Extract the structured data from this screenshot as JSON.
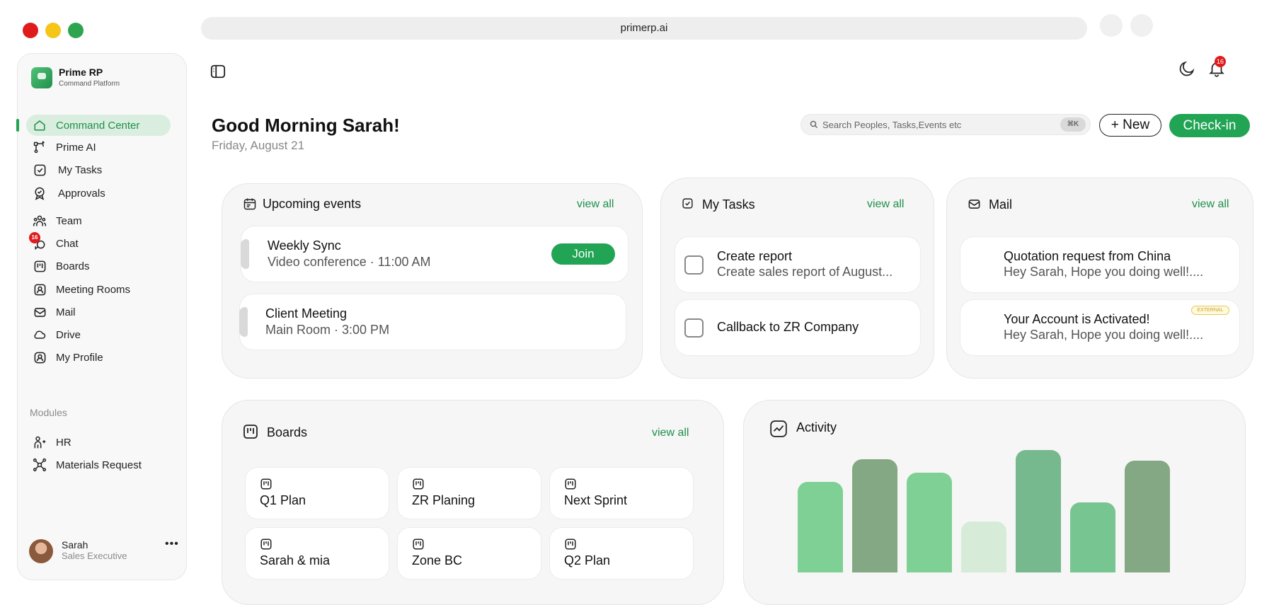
{
  "browser": {
    "url": "primerp.ai",
    "traffic_colors": [
      "#e01b1b",
      "#f5c518",
      "#2ea44f"
    ]
  },
  "brand": {
    "name": "Prime RP",
    "subtitle": "Command Platform"
  },
  "sidebar": {
    "items": [
      {
        "label": "Command Center",
        "icon": "home-icon",
        "active": true
      },
      {
        "label": "Prime AI",
        "icon": "ai-flow-icon"
      },
      {
        "label": "My Tasks",
        "icon": "checkbox-icon"
      },
      {
        "label": "Approvals",
        "icon": "badge-check-icon"
      },
      {
        "label": "Team",
        "icon": "team-icon"
      },
      {
        "label": "Chat",
        "icon": "chat-icon",
        "badge": "16"
      },
      {
        "label": "Boards",
        "icon": "board-icon"
      },
      {
        "label": "Meeting Rooms",
        "icon": "meeting-room-icon"
      },
      {
        "label": "Mail",
        "icon": "mail-icon"
      },
      {
        "label": "Drive",
        "icon": "cloud-icon"
      },
      {
        "label": "My Profile",
        "icon": "profile-icon"
      }
    ],
    "modules_label": "Modules",
    "modules": [
      {
        "label": "HR",
        "icon": "hr-icon"
      },
      {
        "label": "Materials Request",
        "icon": "materials-icon"
      }
    ],
    "user": {
      "name": "Sarah",
      "role": "Sales Executive",
      "more": "•••"
    }
  },
  "topbar": {
    "notification_count": "16"
  },
  "header": {
    "greeting": "Good Morning Sarah!",
    "date": "Friday, August 21",
    "search_placeholder": "Search Peoples, Tasks,Events etc",
    "search_shortcut": "⌘K",
    "new_label": "+ New",
    "checkin_label": "Check-in"
  },
  "events": {
    "title": "Upcoming events",
    "view_all": "view all",
    "items": [
      {
        "title": "Weekly Sync",
        "sub": "Video conference · 11:00 AM",
        "action": "Join"
      },
      {
        "title": "Client Meeting",
        "sub": "Main Room · 3:00 PM"
      }
    ]
  },
  "tasks": {
    "title": "My Tasks",
    "view_all": "view all",
    "items": [
      {
        "title": "Create report",
        "sub": "Create sales report of August..."
      },
      {
        "title": "Callback to ZR Company"
      }
    ]
  },
  "mail": {
    "title": "Mail",
    "view_all": "view all",
    "items": [
      {
        "title": "Quotation request from China",
        "sub": "Hey Sarah, Hope you doing well!...."
      },
      {
        "title": "Your Account is Activated!",
        "sub": "Hey Sarah, Hope you doing well!....",
        "tag": "EXTERNAL"
      }
    ]
  },
  "boards": {
    "title": "Boards",
    "view_all": "view all",
    "items": [
      "Q1 Plan",
      "ZR Planing",
      "Next Sprint",
      "Sarah & mia",
      "Zone BC",
      "Q2 Plan"
    ]
  },
  "activity": {
    "title": "Activity",
    "bar_colors": [
      "#7fd095",
      "#84a784",
      "#7fd095",
      "#d6ecd8",
      "#77b98f",
      "#77c590",
      "#84a784"
    ],
    "bar_levels": [
      0.8,
      1.0,
      0.88,
      0.45,
      1.08,
      0.62,
      0.99
    ]
  }
}
